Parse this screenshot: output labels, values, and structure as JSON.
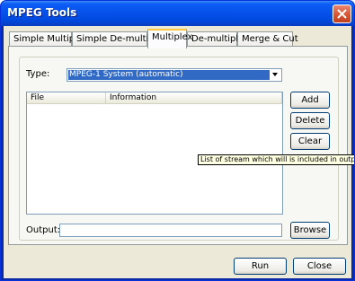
{
  "window": {
    "title": "MPEG Tools"
  },
  "tabs": [
    {
      "label": "Simple Multiplex"
    },
    {
      "label": "Simple De-multiplex"
    },
    {
      "label": "Multiplex"
    },
    {
      "label": "De-multiplex"
    },
    {
      "label": "Merge & Cut"
    }
  ],
  "active_tab": "Multiplex",
  "type_field": {
    "label": "Type:",
    "selected": "MPEG-1 System (automatic)"
  },
  "stream_list": {
    "columns": [
      "File",
      "Information"
    ],
    "rows": []
  },
  "side_buttons": {
    "add": "Add",
    "delete": "Delete",
    "clear": "Clear"
  },
  "tooltip": {
    "text": "List of stream which will is included in output"
  },
  "output_field": {
    "label": "Output:",
    "value": "",
    "browse": "Browse"
  },
  "footer": {
    "run": "Run",
    "close": "Close"
  },
  "colors": {
    "selection": "#316ac5",
    "title_bar": "#0651ea",
    "panel": "#ece9d8"
  }
}
